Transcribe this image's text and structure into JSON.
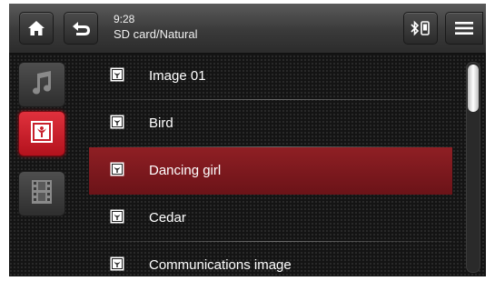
{
  "header": {
    "time": "9:28",
    "path": "SD card/Natural",
    "icons": [
      "home-icon",
      "back-icon",
      "bluetooth-phone-icon",
      "menu-icon"
    ]
  },
  "sidebar": {
    "items": [
      {
        "name": "music",
        "icon": "music-note-icon",
        "active": false
      },
      {
        "name": "pictures",
        "icon": "picture-icon",
        "active": true
      },
      {
        "name": "video",
        "icon": "film-icon",
        "active": false
      }
    ]
  },
  "files": [
    {
      "label": "Image 01",
      "selected": false
    },
    {
      "label": "Bird",
      "selected": false
    },
    {
      "label": "Dancing girl",
      "selected": true
    },
    {
      "label": "Cedar",
      "selected": false
    },
    {
      "label": "Communications image",
      "selected": false
    }
  ],
  "colors": {
    "accent": "#c8202c",
    "selection": "#7a1a1f",
    "text": "#ffffff"
  }
}
